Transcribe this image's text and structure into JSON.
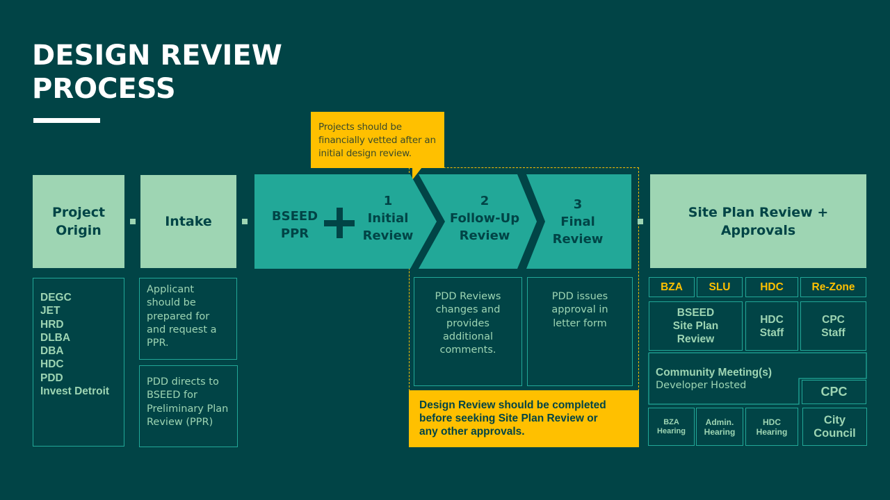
{
  "title": {
    "line1": "DESIGN REVIEW",
    "line2": "PROCESS"
  },
  "callout": {
    "text": "Projects should be financially vetted after an initial design review."
  },
  "stages": {
    "project_origin": {
      "label_line1": "Project",
      "label_line2": "Origin"
    },
    "intake": {
      "label": "Intake"
    },
    "bseed_ppr": {
      "line1": "BSEED",
      "line2": "PPR",
      "joiner": "+"
    },
    "initial_review": {
      "number": "1",
      "line1": "Initial",
      "line2": "Review"
    },
    "follow_up_review": {
      "number": "2",
      "line1": "Follow-Up",
      "line2": "Review"
    },
    "final_review": {
      "number": "3",
      "line1": "Final",
      "line2": "Review"
    },
    "site_plan": {
      "line1": "Site Plan Review +",
      "line2": "Approvals"
    }
  },
  "origin_list": [
    "DEGC",
    "JET",
    "HRD",
    "DLBA",
    "DBA",
    "HDC",
    "PDD",
    "Invest Detroit"
  ],
  "intake_notes": {
    "note1": [
      "Applicant",
      "should be",
      "prepared for",
      "and request a",
      "PPR."
    ],
    "note2": [
      "PDD directs to",
      "BSEED for",
      "Preliminary Plan",
      "Review (PPR)"
    ]
  },
  "review_notes": {
    "follow_up": [
      "PDD Reviews",
      "changes and",
      "provides",
      "additional",
      "comments."
    ],
    "final": [
      "PDD issues",
      "approval in",
      "letter form"
    ]
  },
  "completion_note": [
    "Design Review should be completed",
    "before seeking Site Plan Review or",
    "any other approvals."
  ],
  "approvals": {
    "tags": [
      "BZA",
      "SLU",
      "HDC",
      "Re-Zone"
    ],
    "bseed_site_plan": [
      "BSEED",
      "Site Plan",
      "Review"
    ],
    "hdc_staff": [
      "HDC",
      "Staff"
    ],
    "cpc_staff": [
      "CPC",
      "Staff"
    ],
    "community_meeting": {
      "title": "Community Meeting(s)",
      "subtitle": "Developer Hosted"
    },
    "cpc": "CPC",
    "bza_hearing": [
      "BZA",
      "Hearing"
    ],
    "admin_hearing": [
      "Admin.",
      "Hearing"
    ],
    "hdc_hearing": [
      "HDC",
      "Hearing"
    ],
    "city_council": [
      "City",
      "Council"
    ]
  },
  "colors": {
    "background": "#014446",
    "light_green": "#9ED5B3",
    "teal": "#22A898",
    "yellow": "#FFC000",
    "white": "#FFFFFF"
  }
}
